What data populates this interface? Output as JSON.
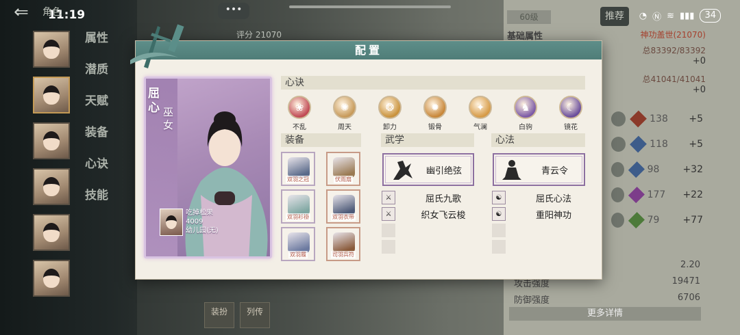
{
  "status_bar": {
    "time": "11:19",
    "battery": "34"
  },
  "background": {
    "top_title": "角色",
    "chat": "•••",
    "score": "评分 21070",
    "level": "60级",
    "rank_button": "推荐",
    "side_tabs": [
      "属性",
      "潜质",
      "天赋",
      "装备",
      "心诀",
      "技能"
    ],
    "stats": {
      "basic_label": "基础属性",
      "title_value": "神功盖世(21070)",
      "hp": "总83392/83392",
      "hp_plus": "+0",
      "mp": "总41041/41041",
      "mp_plus": "+0",
      "rows": [
        {
          "value": "138",
          "plus": "+5"
        },
        {
          "value": "118",
          "plus": "+5"
        },
        {
          "value": "98",
          "plus": "+32"
        },
        {
          "value": "177",
          "plus": "+22"
        },
        {
          "value": "79",
          "plus": "+77"
        }
      ]
    },
    "bottom_stats": [
      {
        "label": "",
        "value": "2.20"
      },
      {
        "label": "攻击强度",
        "value": "19471"
      },
      {
        "label": "防御强度",
        "value": "6706"
      }
    ],
    "more_button": "更多详情",
    "bottom_tabs": [
      "装扮",
      "列传"
    ]
  },
  "dialog": {
    "title": "配置",
    "portrait": {
      "name": "屈心",
      "title": "巫女",
      "owner_name": "吃掉松果",
      "owner_id": "4009",
      "owner_guild": "幼儿园(无)"
    },
    "xinjue": {
      "header": "心诀",
      "skills": [
        {
          "label": "不乱",
          "color": "#c04a55",
          "glyph": "❀"
        },
        {
          "label": "周天",
          "color": "#c79a5a",
          "glyph": "✺"
        },
        {
          "label": "卸力",
          "color": "#c9923c",
          "glyph": "❂"
        },
        {
          "label": "锻骨",
          "color": "#c8873a",
          "glyph": "✹"
        },
        {
          "label": "气澜",
          "color": "#d69a46",
          "glyph": "✦"
        },
        {
          "label": "白驹",
          "color": "#7c5aa6",
          "glyph": "♞"
        },
        {
          "label": "镜花",
          "color": "#6a4e9c",
          "glyph": "☾"
        }
      ]
    },
    "equip": {
      "header": "装备",
      "items": [
        {
          "label": "双羽之冠",
          "color": "#5a6a8a"
        },
        {
          "label": "伏雨扇",
          "color": "#9a7a52"
        },
        {
          "label": "双羽衫褂",
          "color": "#7fa7a2"
        },
        {
          "label": "双羽衣带",
          "color": "#4d5a78"
        },
        {
          "label": "双羽履",
          "color": "#6c7aa0"
        },
        {
          "label": "司羽兵符",
          "color": "#8a5a3a"
        }
      ]
    },
    "wuxue": {
      "header": "武学",
      "main": "幽引绝弦",
      "subs": [
        "屈氏九歌",
        "织女飞云梭"
      ]
    },
    "xinfa": {
      "header": "心法",
      "main": "青云令",
      "subs": [
        "屈氏心法",
        "重阳神功"
      ]
    }
  }
}
